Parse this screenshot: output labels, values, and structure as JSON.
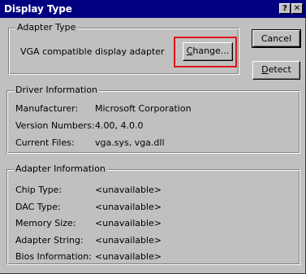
{
  "window": {
    "title": "Display Type",
    "help_icon_glyph": "?",
    "close_icon_glyph": "✕"
  },
  "buttons": {
    "cancel": "Cancel",
    "detect_mnemonic": "D",
    "detect_rest": "etect",
    "change_mnemonic": "C",
    "change_rest": "hange..."
  },
  "adapter_type": {
    "label": "Adapter Type",
    "value": "VGA compatible display adapter"
  },
  "driver_information": {
    "label": "Driver Information",
    "rows": [
      {
        "key": "Manufacturer:",
        "value": "Microsoft Corporation"
      },
      {
        "key": "Version Numbers:",
        "value": "4.00, 4.0.0"
      },
      {
        "key": "Current Files:",
        "value": "vga.sys, vga.dll"
      }
    ]
  },
  "adapter_information": {
    "label": "Adapter Information",
    "rows": [
      {
        "key": "Chip Type:",
        "value": "<unavailable>"
      },
      {
        "key": "DAC Type:",
        "value": "<unavailable>"
      },
      {
        "key": "Memory Size:",
        "value": "<unavailable>"
      },
      {
        "key": "Adapter String:",
        "value": "<unavailable>"
      },
      {
        "key": "Bios Information:",
        "value": "<unavailable>"
      }
    ]
  },
  "colors": {
    "titlebar": "#000080",
    "face": "#c0c0c0",
    "highlight_box": "#e0141e"
  }
}
